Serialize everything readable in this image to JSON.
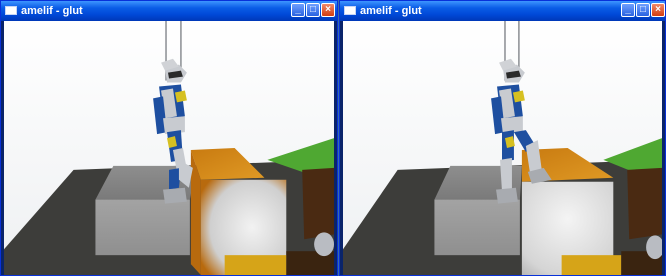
{
  "windows": [
    {
      "title": "amelif - glut",
      "icon": "glut-window-icon",
      "controls": [
        "minimize",
        "maximize",
        "close"
      ]
    },
    {
      "title": "amelif - glut",
      "icon": "glut-window-icon",
      "controls": [
        "minimize",
        "maximize",
        "close"
      ]
    }
  ],
  "colors": {
    "titlebar": "#0a5ce6",
    "sky": "#ffffff",
    "ground": "#3d3d3a",
    "box_orange": "#d98b12",
    "box_gray": "#a8a8a8",
    "grass": "#4fa832",
    "robot_blue": "#1e4fa0",
    "robot_silver": "#c8cbd0",
    "robot_yellow": "#d6c021"
  }
}
